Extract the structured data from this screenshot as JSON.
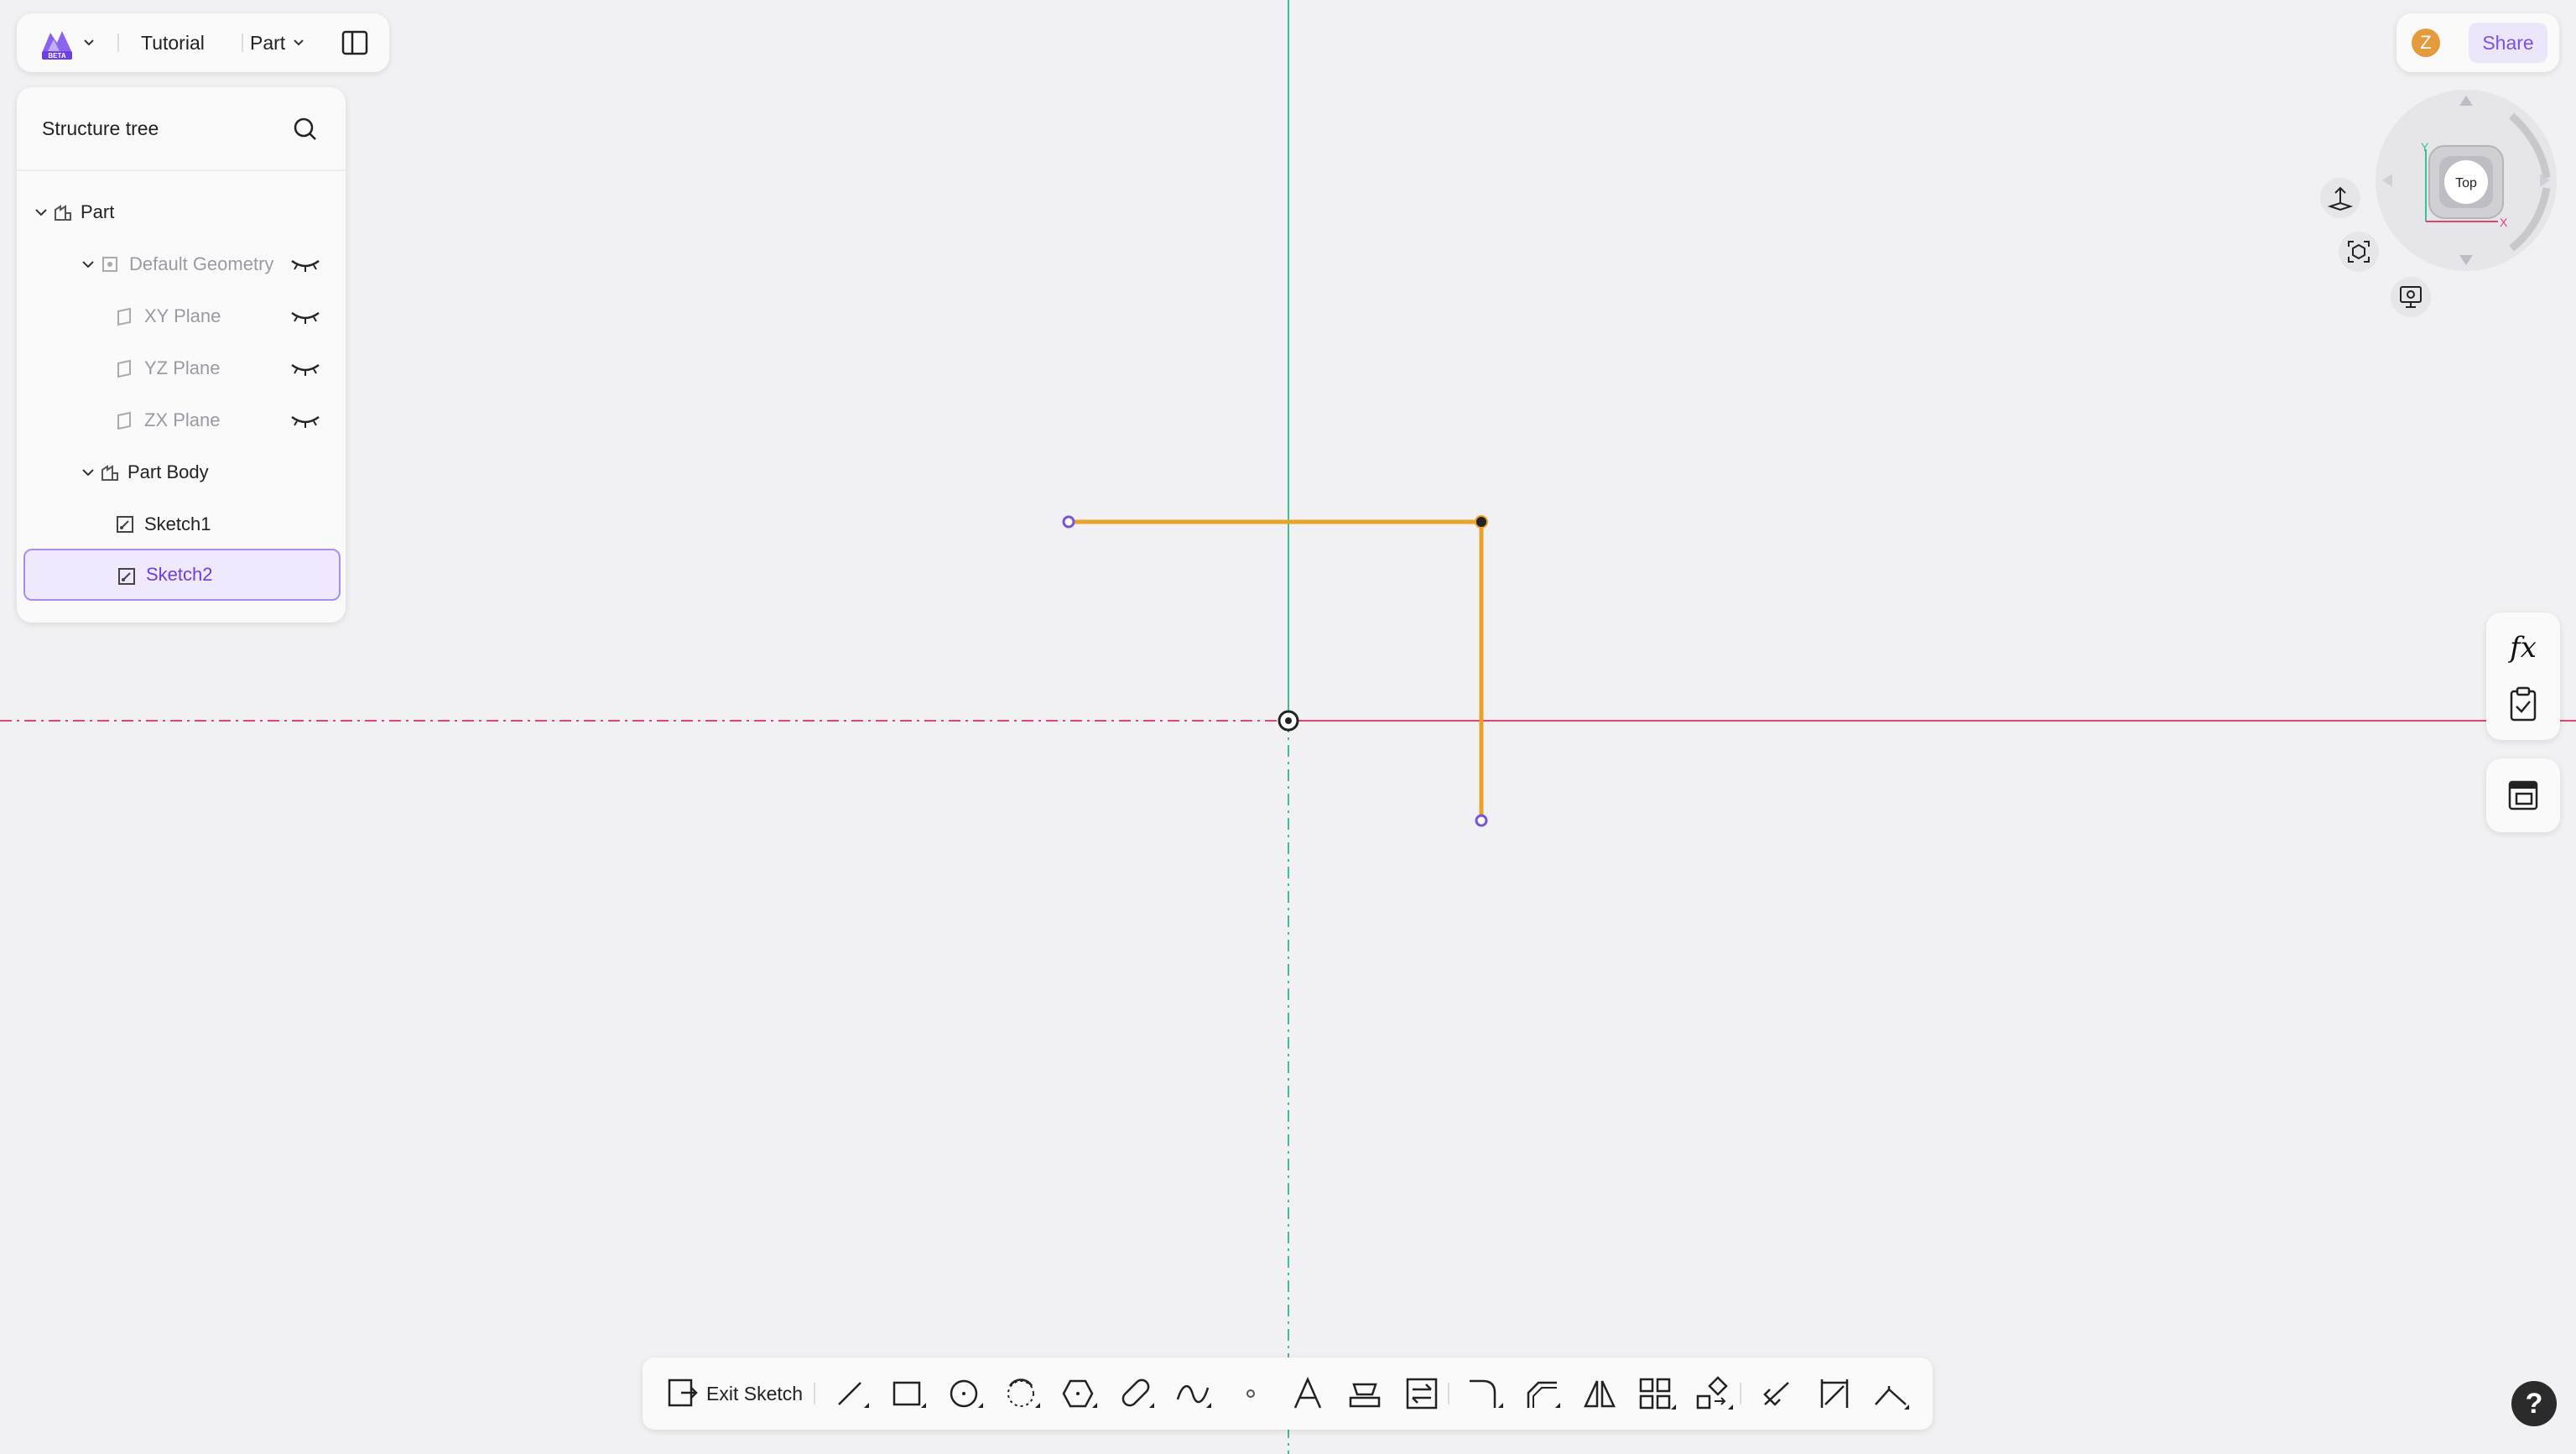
{
  "header": {
    "project_name": "Tutorial",
    "mode_label": "Part",
    "logo_badge": "BETA"
  },
  "structure_tree": {
    "title": "Structure tree",
    "items": [
      {
        "label": "Part"
      },
      {
        "label": "Default Geometry"
      },
      {
        "label": "XY Plane"
      },
      {
        "label": "YZ Plane"
      },
      {
        "label": "ZX Plane"
      },
      {
        "label": "Part Body"
      },
      {
        "label": "Sketch1"
      },
      {
        "label": "Sketch2",
        "selected": true
      }
    ]
  },
  "user": {
    "avatar_initial": "Z",
    "share_label": "Share"
  },
  "view_cube": {
    "face_label": "Top",
    "axis_x": "X",
    "axis_y": "Y"
  },
  "side_panel": {
    "formula_label": "fx"
  },
  "toolbar": {
    "exit_label": "Exit Sketch",
    "tools": [
      "line-icon",
      "rectangle-icon",
      "circle-icon",
      "arc-icon",
      "polygon-icon",
      "slot-icon",
      "spline-icon",
      "point-icon",
      "text-icon",
      "offset-icon",
      "convert-icon",
      "fillet-icon",
      "chamfer-icon",
      "mirror-icon",
      "pattern-icon",
      "transform-icon",
      "trim-icon",
      "dimension-icon",
      "constraint-icon"
    ]
  },
  "help_label": "?",
  "colors": {
    "accent": "#7a52e0",
    "sketch_line": "#e8a22a",
    "x_axis": "#e0466b",
    "y_axis": "#3cbf95",
    "background": "#f1f1f3"
  }
}
